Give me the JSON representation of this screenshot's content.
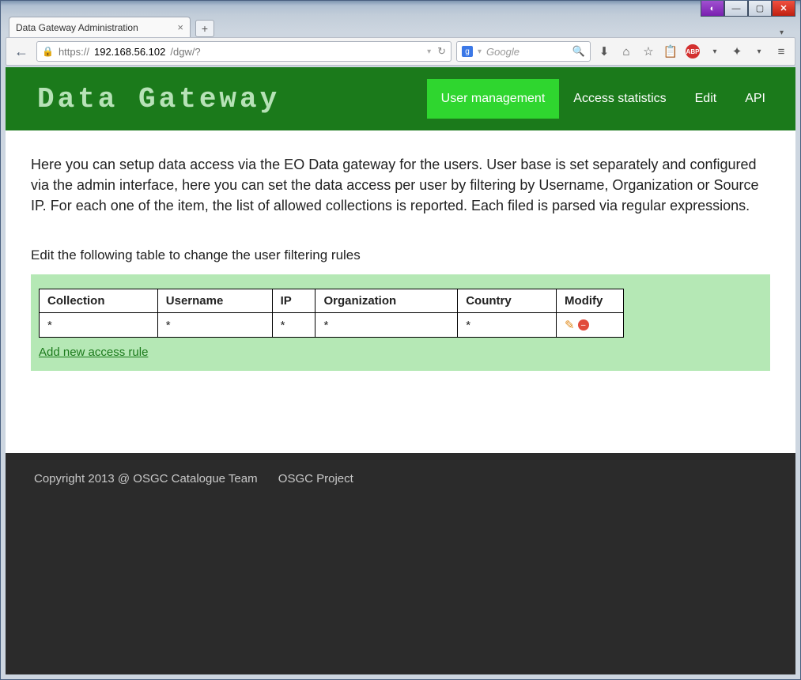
{
  "window": {
    "tab_title": "Data Gateway Administration",
    "url_prefix": "https://",
    "url_host": "192.168.56.102",
    "url_path": "/dgw/?",
    "search_placeholder": "Google"
  },
  "header": {
    "logo": "Data Gateway",
    "nav": {
      "user_mgmt": "User management",
      "access_stats": "Access statistics",
      "edit": "Edit",
      "api": "API"
    }
  },
  "content": {
    "intro": "Here you can setup data access via the EO Data gateway for the users. User base is set separately and configured via the admin interface, here you can set the data access per user by filtering by Username, Organization or Source IP. For each one of the item, the list of allowed collections is reported. Each filed is parsed via regular expressions.",
    "subhead": "Edit the following table to change the user filtering rules",
    "table": {
      "headers": {
        "collection": "Collection",
        "username": "Username",
        "ip": "IP",
        "organization": "Organization",
        "country": "Country",
        "modify": "Modify"
      },
      "rows": [
        {
          "collection": "*",
          "username": "*",
          "ip": "*",
          "organization": "*",
          "country": "*"
        }
      ]
    },
    "add_link": "Add new access rule"
  },
  "footer": {
    "copyright": "Copyright 2013 @ OSGC Catalogue Team",
    "project": "OSGC Project"
  }
}
